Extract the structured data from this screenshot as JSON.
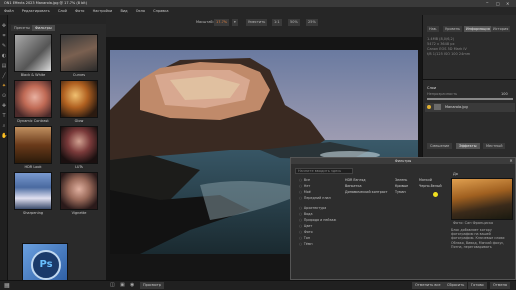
{
  "window": {
    "title": "ON1 Effects 2023  Manarola.jpg @ 17.7% (8 bit)"
  },
  "menu": [
    "Файл",
    "Редактировать",
    "Слой",
    "Фото",
    "Настройки",
    "Вид",
    "Окно",
    "Справка"
  ],
  "presets": {
    "tabs": [
      "Пресеты",
      "Фильтры"
    ],
    "items": [
      {
        "label": "Black & White",
        "color": "#8a8a8a"
      },
      {
        "label": "Curves",
        "color": "#5a4a40"
      },
      {
        "label": "Dynamic Contrast",
        "color": "#b06a55"
      },
      {
        "label": "Glow",
        "color": "#c07a30"
      },
      {
        "label": "HDR Look",
        "color": "#7a4a2a"
      },
      {
        "label": "LUTs",
        "color": "#6a3a3a"
      },
      {
        "label": "Sharpening",
        "color": "#4a6aa0"
      },
      {
        "label": "Vignette",
        "color": "#9a6a5a"
      }
    ],
    "logo_text": "Ps"
  },
  "toolbar": {
    "zoom_label": "Масштаб:",
    "zoom_value": "17.7%",
    "fit_label": "Уместить",
    "buttons": [
      "1:1",
      "50%",
      "25%"
    ]
  },
  "right": {
    "top_tabs": [
      "Нав.",
      "Уровень",
      "Информация",
      "История"
    ],
    "info_lines": [
      "1.4MB (8,0/6,2)",
      "5472 x 3648 px",
      "Canon EOS 5D Mark IV",
      "f/8  1/125  ISO 100  24mm"
    ],
    "section_layers": "Слои",
    "opacity_label": "Непрозрачность",
    "opacity_value": "100",
    "layer_name": "Manarola.jpg",
    "bottom_tabs": [
      "Смешение",
      "Эффекты",
      "Местный"
    ],
    "add_filter": "Добавить фильтр"
  },
  "dialog": {
    "title": "Фильтры",
    "search_label": "Начните вводить здесь",
    "categories": [
      "Все",
      "Нет",
      "Моё",
      "Передний план",
      "Архитектура",
      "Вода",
      "Природа и пейзаж",
      "Цвет",
      "Фото",
      "Тон",
      "Тёмн"
    ],
    "filters": [
      [
        "HDR Взгляд",
        "Зелень",
        "Мягкий"
      ],
      [
        "Виньетка",
        "Кривые",
        "Черно-белый"
      ],
      [
        "Динамический контраст",
        "Туман",
        ""
      ]
    ],
    "preview_title": "Фото: Сан Франциско",
    "description": "Блок добавляет котору фотографию на вашей фотографию. Ключевые слова: Облако, Вивид, Мягкий фокус, Пятна, переговаривать",
    "desc_title": "До"
  },
  "bottom": {
    "left_btn": "Просмотр",
    "buttons": [
      "Отменить все",
      "Сбросить",
      "Готово",
      "Отмена"
    ]
  }
}
